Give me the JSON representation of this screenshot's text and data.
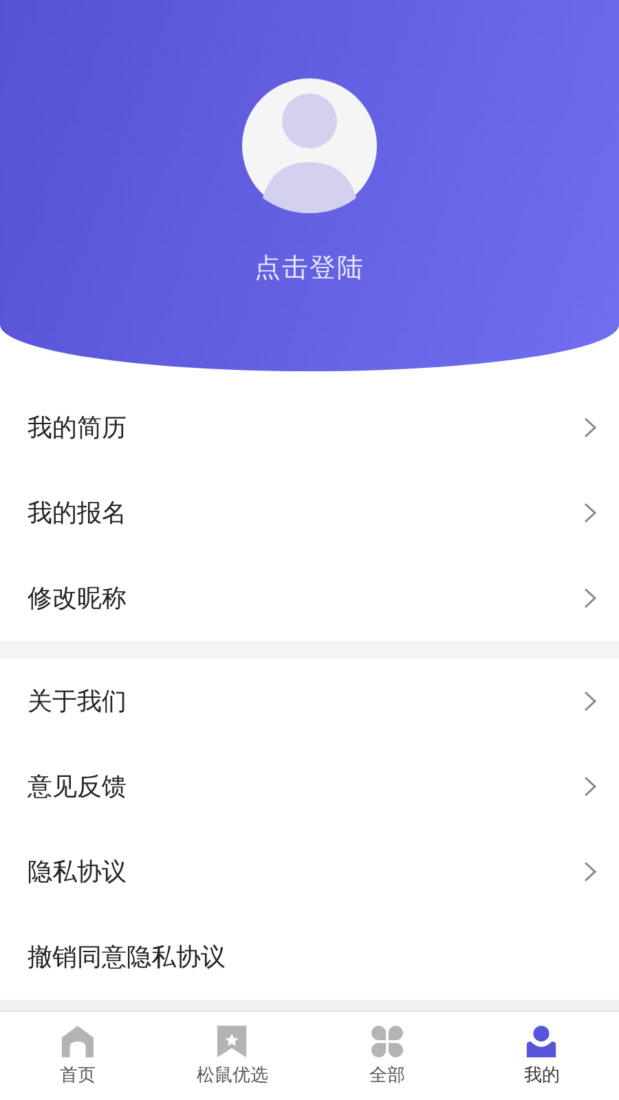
{
  "header": {
    "login_label": "点击登陆"
  },
  "menu_groups": [
    {
      "items": [
        {
          "label": "我的简历",
          "chevron": true
        },
        {
          "label": "我的报名",
          "chevron": true
        },
        {
          "label": "修改昵称",
          "chevron": true
        }
      ]
    },
    {
      "items": [
        {
          "label": "关于我们",
          "chevron": true
        },
        {
          "label": "意见反馈",
          "chevron": true
        },
        {
          "label": "隐私协议",
          "chevron": true
        },
        {
          "label": "撤销同意隐私协议",
          "chevron": false
        }
      ]
    }
  ],
  "tab_bar": [
    {
      "label": "首页",
      "selected": false
    },
    {
      "label": "松鼠优选",
      "selected": false
    },
    {
      "label": "全部",
      "selected": false
    },
    {
      "label": "我的",
      "selected": true
    }
  ]
}
